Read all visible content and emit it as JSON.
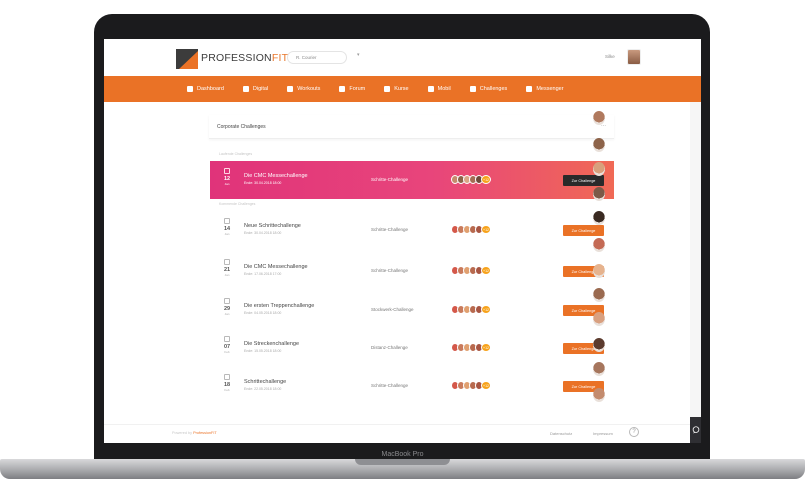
{
  "device": {
    "brand": "MacBook Pro"
  },
  "header": {
    "logo_main": "PROFESSION",
    "logo_accent": "FIT",
    "org_selector": "R. Courier",
    "user_name": "Silke"
  },
  "nav": {
    "items": [
      {
        "label": "Dashboard",
        "icon": "home-icon"
      },
      {
        "label": "Digital",
        "icon": "play-icon"
      },
      {
        "label": "Workouts",
        "icon": "dumbbell-icon"
      },
      {
        "label": "Forum",
        "icon": "chat-icon"
      },
      {
        "label": "Kurse",
        "icon": "calendar-icon"
      },
      {
        "label": "Mobil",
        "icon": "phone-icon"
      },
      {
        "label": "Challenges",
        "icon": "trophy-icon"
      },
      {
        "label": "Messenger",
        "icon": "message-icon"
      }
    ]
  },
  "main": {
    "title": "Corporate Challenges",
    "menu": "...",
    "section_active": "Laufende Challenges",
    "section_upcoming": "Kommende Challenges",
    "active_challenge": {
      "day": "12",
      "month": "Jan",
      "title": "Die CMC Messechallenge",
      "subtitle": "Ende: 30.04.2018 18:00",
      "type": "Schritte-Challenge",
      "count": "+12",
      "button": "Zur Challenge"
    },
    "challenges": [
      {
        "day": "14",
        "month": "Jan",
        "title": "Neue Schrittechallenge",
        "subtitle": "Ende: 30.04.2018 18:00",
        "type": "Schritte-Challenge",
        "count": "+12",
        "button": "Zur Challenge"
      },
      {
        "day": "21",
        "month": "Jan",
        "title": "Die CMC Messechallenge",
        "subtitle": "Ende: 17.06.2018 17:00",
        "type": "Schritte-Challenge",
        "count": "+12",
        "button": "Zur Challenge"
      },
      {
        "day": "29",
        "month": "Jan",
        "title": "Die ersten Treppenchallenge",
        "subtitle": "Ende: 04.05.2018 18:00",
        "type": "Stockwerk-Challenge",
        "count": "+12",
        "button": "Zur Challenge"
      },
      {
        "day": "07",
        "month": "Feb",
        "title": "Die Streckenchallenge",
        "subtitle": "Ende: 15.05.2018 18:00",
        "type": "Distanz-Challenge",
        "count": "+12",
        "button": "Zur Challenge"
      },
      {
        "day": "18",
        "month": "Feb",
        "title": "Schrittechallenge",
        "subtitle": "Ende: 22.05.2018 18:00",
        "type": "Schritte-Challenge",
        "count": "+12",
        "button": "Zur Challenge"
      }
    ]
  },
  "footer": {
    "copyright": "Powered by ",
    "copyright_accent": "ProfessionFIT",
    "privacy": "Datenschutz",
    "imprint": "Impressum",
    "help": "?"
  },
  "colors": {
    "brand_orange": "#ea7226",
    "active_gradient_start": "#e0337a",
    "active_gradient_end": "#f06955",
    "dark_button": "#2a2a2a"
  }
}
